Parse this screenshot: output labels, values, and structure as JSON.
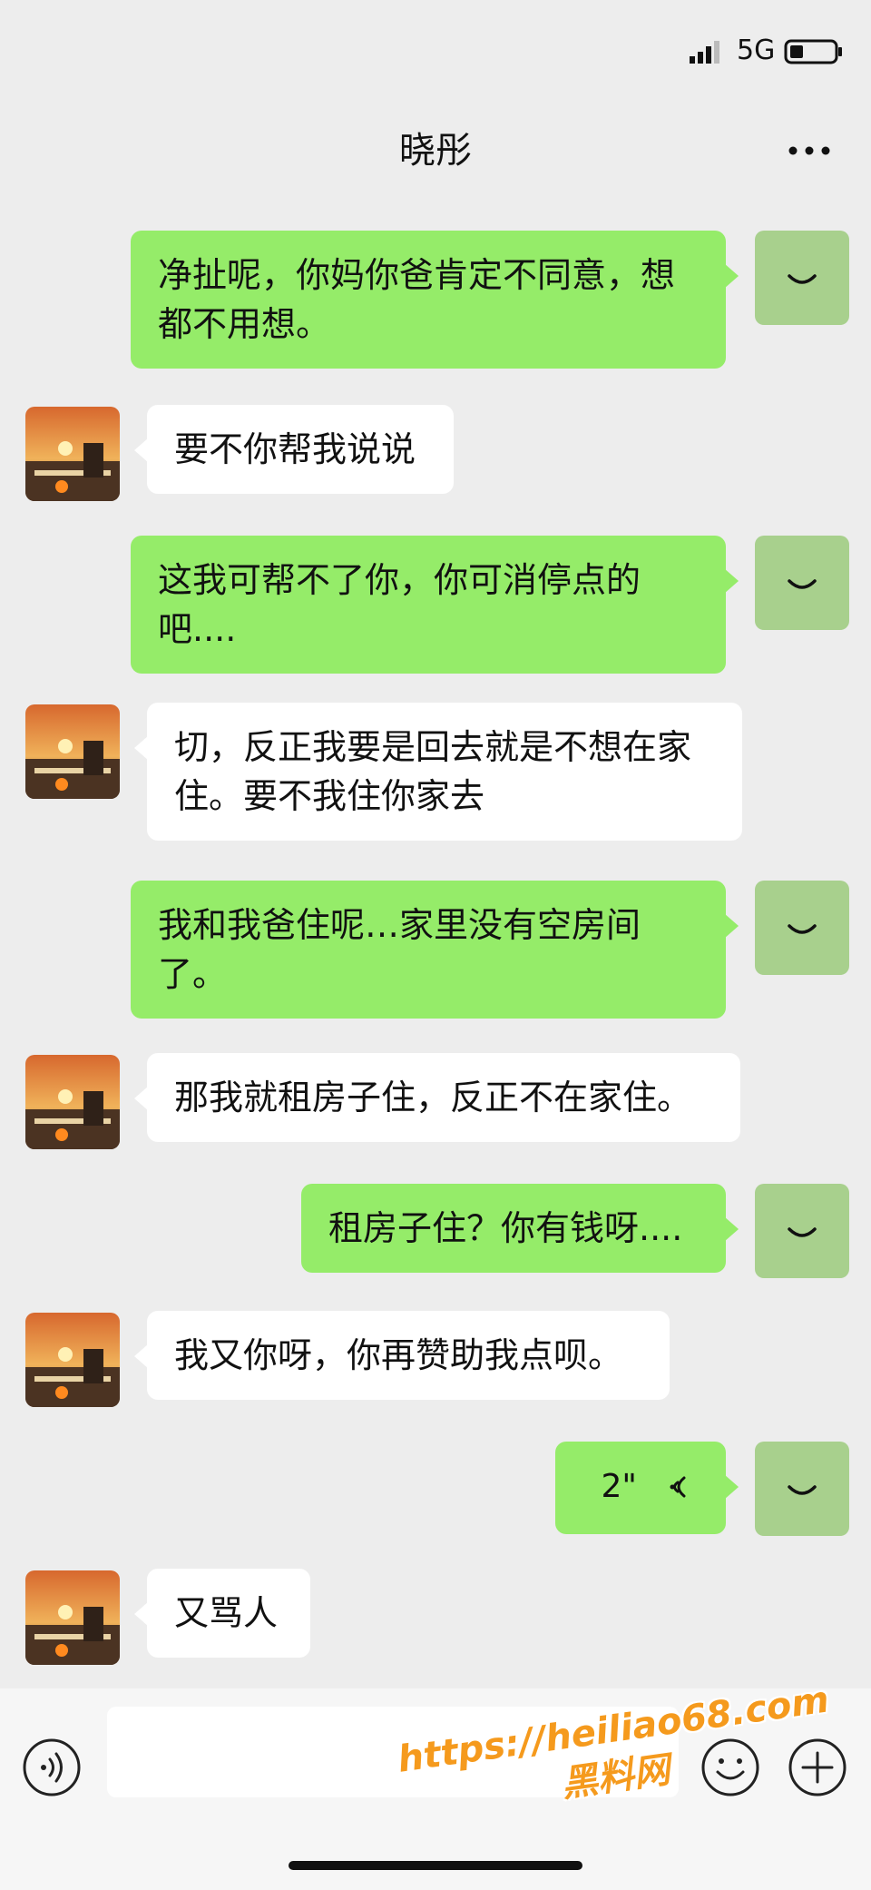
{
  "status_bar": {
    "network": "5G",
    "icons": [
      "signal-bars-icon",
      "battery-icon"
    ]
  },
  "header": {
    "title": "晓彤",
    "more_icon": "more-dots-icon"
  },
  "messages": [
    {
      "direction": "out",
      "type": "text",
      "text": "净扯呢，你妈你爸肯定不同意，想都不用想。"
    },
    {
      "direction": "in",
      "type": "text",
      "text": "要不你帮我说说"
    },
    {
      "direction": "out",
      "type": "text",
      "text": "这我可帮不了你，你可消停点的吧...."
    },
    {
      "direction": "in",
      "type": "text",
      "text": "切，反正我要是回去就是不想在家住。要不我住你家去"
    },
    {
      "direction": "out",
      "type": "text",
      "text": "我和我爸住呢…家里没有空房间了。"
    },
    {
      "direction": "in",
      "type": "text",
      "text": "那我就租房子住，反正不在家住。"
    },
    {
      "direction": "out",
      "type": "text",
      "text": "租房子住？你有钱呀...."
    },
    {
      "direction": "in",
      "type": "text",
      "text": "我又你呀，你再赞助我点呗。"
    },
    {
      "direction": "out",
      "type": "voice",
      "text": "2\""
    },
    {
      "direction": "in",
      "type": "text",
      "text": "又骂人"
    }
  ],
  "input_bar": {
    "placeholder": "",
    "icons": [
      "voice-toggle-icon",
      "emoji-icon",
      "add-icon"
    ]
  },
  "watermark": {
    "url": "https://heiliao68.com",
    "site": "黑料网"
  },
  "colors": {
    "background": "#ededed",
    "outgoing_bubble": "#95ec69",
    "incoming_bubble": "#ffffff",
    "watermark": "#f59a1d"
  }
}
